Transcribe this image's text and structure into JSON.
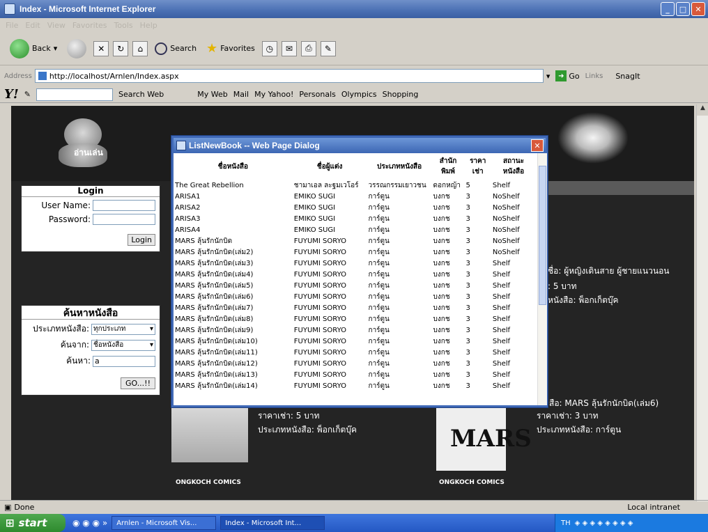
{
  "window": {
    "title": "Index - Microsoft Internet Explorer"
  },
  "menu": {
    "items": [
      "File",
      "Edit",
      "View",
      "Favorites",
      "Tools",
      "Help"
    ]
  },
  "toolbar": {
    "back": "Back",
    "search": "Search",
    "favorites": "Favorites"
  },
  "address": {
    "label": "Address",
    "url": "http://localhost/Arnlen/Index.aspx",
    "go": "Go",
    "links": "Links",
    "snagit": "SnagIt"
  },
  "yahoo": {
    "search_web": "Search Web",
    "my_web": "My Web",
    "mail": "Mail",
    "my_yahoo": "My Yahoo!",
    "personals": "Personals",
    "olympics": "Olympics",
    "shopping": "Shopping"
  },
  "logo": {
    "text": "อ่านเล่น"
  },
  "login": {
    "title": "Login",
    "username_label": "User Name:",
    "password_label": "Password:",
    "button": "Login"
  },
  "search": {
    "title": "ค้นหาหนังสือ",
    "type_label": "ประเภทหนังสือ:",
    "type_value": "ทุกประเภท",
    "from_label": "ค้นจาก:",
    "from_value": "ชื่อหนังสือ",
    "keyword_label": "ค้นหา:",
    "keyword_value": "a",
    "button": "GO...!!"
  },
  "right_panel": {
    "line1": "ชื่อ: ผู้หญิงเดินสาย ผู้ชายแนวนอน",
    "line2": ": 5 บาท",
    "line3": "หนังสือ: พ็อกเก็ตบุ๊ค",
    "line4": "สือ: MARS ลุ้นรักนักบิด(เล่ม6)"
  },
  "bottom": {
    "book1_price": "ราคาเช่า: 5 บาท",
    "book1_type": "ประเภทหนังสือ: พ็อกเก็ตบุ๊ค",
    "book2_price": "ราคาเช่า: 3 บาท",
    "book2_type": "ประเภทหนังสือ: การ์ตูน",
    "comics": "ONGKOCH COMICS",
    "mars": "MARS"
  },
  "dialog": {
    "title": "ListNewBook -- Web Page Dialog",
    "headers": [
      "ชื่อหนังสือ",
      "ชื่อผู้แต่ง",
      "ประเภทหนังสือ",
      "สำนักพิมพ์",
      "ราคาเช่า",
      "สถานะหนังสือ"
    ],
    "rows": [
      [
        "The Great Rebellion",
        "ชามาเอล ละฐมเวโอร์",
        "วรรณกรรมเยาวชน",
        "ดอกหญ้า",
        "5",
        "Shelf"
      ],
      [
        "ARISA1",
        "EMIKO SUGI",
        "การ์ตูน",
        "บงกช",
        "3",
        "NoShelf"
      ],
      [
        "ARISA2",
        "EMIKO SUGI",
        "การ์ตูน",
        "บงกช",
        "3",
        "NoShelf"
      ],
      [
        "ARISA3",
        "EMIKO SUGI",
        "การ์ตูน",
        "บงกช",
        "3",
        "NoShelf"
      ],
      [
        "ARISA4",
        "EMIKO SUGI",
        "การ์ตูน",
        "บงกช",
        "3",
        "NoShelf"
      ],
      [
        "MARS ลุ้นรักนักบิด",
        "FUYUMI SORYO",
        "การ์ตูน",
        "บงกช",
        "3",
        "NoShelf"
      ],
      [
        "MARS ลุ้นรักนักบิด(เล่ม2)",
        "FUYUMI SORYO",
        "การ์ตูน",
        "บงกช",
        "3",
        "NoShelf"
      ],
      [
        "MARS ลุ้นรักนักบิด(เล่ม3)",
        "FUYUMI SORYO",
        "การ์ตูน",
        "บงกช",
        "3",
        "Shelf"
      ],
      [
        "MARS ลุ้นรักนักบิด(เล่ม4)",
        "FUYUMI SORYO",
        "การ์ตูน",
        "บงกช",
        "3",
        "Shelf"
      ],
      [
        "MARS ลุ้นรักนักบิด(เล่ม5)",
        "FUYUMI SORYO",
        "การ์ตูน",
        "บงกช",
        "3",
        "Shelf"
      ],
      [
        "MARS ลุ้นรักนักบิด(เล่ม6)",
        "FUYUMI SORYO",
        "การ์ตูน",
        "บงกช",
        "3",
        "Shelf"
      ],
      [
        "MARS ลุ้นรักนักบิด(เล่ม7)",
        "FUYUMI SORYO",
        "การ์ตูน",
        "บงกช",
        "3",
        "Shelf"
      ],
      [
        "MARS ลุ้นรักนักบิด(เล่ม8)",
        "FUYUMI SORYO",
        "การ์ตูน",
        "บงกช",
        "3",
        "Shelf"
      ],
      [
        "MARS ลุ้นรักนักบิด(เล่ม9)",
        "FUYUMI SORYO",
        "การ์ตูน",
        "บงกช",
        "3",
        "Shelf"
      ],
      [
        "MARS ลุ้นรักนักบิด(เล่ม10)",
        "FUYUMI SORYO",
        "การ์ตูน",
        "บงกช",
        "3",
        "Shelf"
      ],
      [
        "MARS ลุ้นรักนักบิด(เล่ม11)",
        "FUYUMI SORYO",
        "การ์ตูน",
        "บงกช",
        "3",
        "Shelf"
      ],
      [
        "MARS ลุ้นรักนักบิด(เล่ม12)",
        "FUYUMI SORYO",
        "การ์ตูน",
        "บงกช",
        "3",
        "Shelf"
      ],
      [
        "MARS ลุ้นรักนักบิด(เล่ม13)",
        "FUYUMI SORYO",
        "การ์ตูน",
        "บงกช",
        "3",
        "Shelf"
      ],
      [
        "MARS ลุ้นรักนักบิด(เล่ม14)",
        "FUYUMI SORYO",
        "การ์ตูน",
        "บงกช",
        "3",
        "Shelf"
      ]
    ]
  },
  "status": {
    "left": "Done",
    "right": "Local intranet"
  },
  "taskbar": {
    "start": "start",
    "task1": "Arnlen - Microsoft Vis...",
    "task2": "Index - Microsoft Int...",
    "lang": "TH"
  }
}
